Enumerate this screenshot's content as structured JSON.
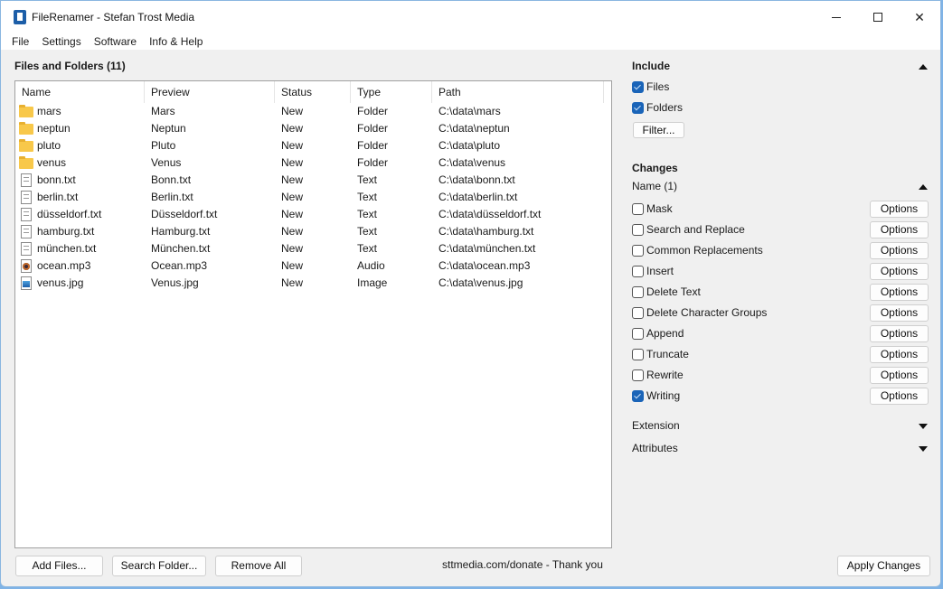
{
  "window": {
    "title": "FileRenamer - Stefan Trost Media",
    "controls": {
      "minimize": "minimize-icon",
      "maximize": "maximize-icon",
      "close": "✕"
    }
  },
  "menu": [
    "File",
    "Settings",
    "Software",
    "Info & Help"
  ],
  "files_panel": {
    "title": "Files and Folders (11)",
    "columns": [
      "Name",
      "Preview",
      "Status",
      "Type",
      "Path"
    ],
    "rows": [
      {
        "icon": "folder",
        "name": "mars",
        "preview": "Mars",
        "status": "New",
        "type": "Folder",
        "path": "C:\\data\\mars"
      },
      {
        "icon": "folder",
        "name": "neptun",
        "preview": "Neptun",
        "status": "New",
        "type": "Folder",
        "path": "C:\\data\\neptun"
      },
      {
        "icon": "folder",
        "name": "pluto",
        "preview": "Pluto",
        "status": "New",
        "type": "Folder",
        "path": "C:\\data\\pluto"
      },
      {
        "icon": "folder",
        "name": "venus",
        "preview": "Venus",
        "status": "New",
        "type": "Folder",
        "path": "C:\\data\\venus"
      },
      {
        "icon": "text",
        "name": "bonn.txt",
        "preview": "Bonn.txt",
        "status": "New",
        "type": "Text",
        "path": "C:\\data\\bonn.txt"
      },
      {
        "icon": "text",
        "name": "berlin.txt",
        "preview": "Berlin.txt",
        "status": "New",
        "type": "Text",
        "path": "C:\\data\\berlin.txt"
      },
      {
        "icon": "text",
        "name": "düsseldorf.txt",
        "preview": "Düsseldorf.txt",
        "status": "New",
        "type": "Text",
        "path": "C:\\data\\düsseldorf.txt"
      },
      {
        "icon": "text",
        "name": "hamburg.txt",
        "preview": "Hamburg.txt",
        "status": "New",
        "type": "Text",
        "path": "C:\\data\\hamburg.txt"
      },
      {
        "icon": "text",
        "name": "münchen.txt",
        "preview": "München.txt",
        "status": "New",
        "type": "Text",
        "path": "C:\\data\\münchen.txt"
      },
      {
        "icon": "audio",
        "name": "ocean.mp3",
        "preview": "Ocean.mp3",
        "status": "New",
        "type": "Audio",
        "path": "C:\\data\\ocean.mp3"
      },
      {
        "icon": "image",
        "name": "venus.jpg",
        "preview": "Venus.jpg",
        "status": "New",
        "type": "Image",
        "path": "C:\\data\\venus.jpg"
      }
    ],
    "buttons": {
      "add_files": "Add Files...",
      "search_folder": "Search Folder...",
      "remove_all": "Remove All"
    },
    "donate_text": "sttmedia.com/donate - Thank you"
  },
  "include": {
    "title": "Include",
    "files": {
      "label": "Files",
      "checked": true
    },
    "folders": {
      "label": "Folders",
      "checked": true
    },
    "filter_button": "Filter..."
  },
  "changes": {
    "title": "Changes",
    "name_group": "Name (1)",
    "options_label": "Options",
    "items": [
      {
        "label": "Mask",
        "checked": false
      },
      {
        "label": "Search and Replace",
        "checked": false
      },
      {
        "label": "Common Replacements",
        "checked": false
      },
      {
        "label": "Insert",
        "checked": false
      },
      {
        "label": "Delete Text",
        "checked": false
      },
      {
        "label": "Delete Character Groups",
        "checked": false
      },
      {
        "label": "Append",
        "checked": false
      },
      {
        "label": "Truncate",
        "checked": false
      },
      {
        "label": "Rewrite",
        "checked": false
      },
      {
        "label": "Writing",
        "checked": true
      }
    ],
    "extension_group": "Extension",
    "attributes_group": "Attributes"
  },
  "apply_button": "Apply Changes",
  "colors": {
    "accent": "#1a64b8",
    "folder": "#f8c84a",
    "window_bg": "#f0f0f0"
  }
}
